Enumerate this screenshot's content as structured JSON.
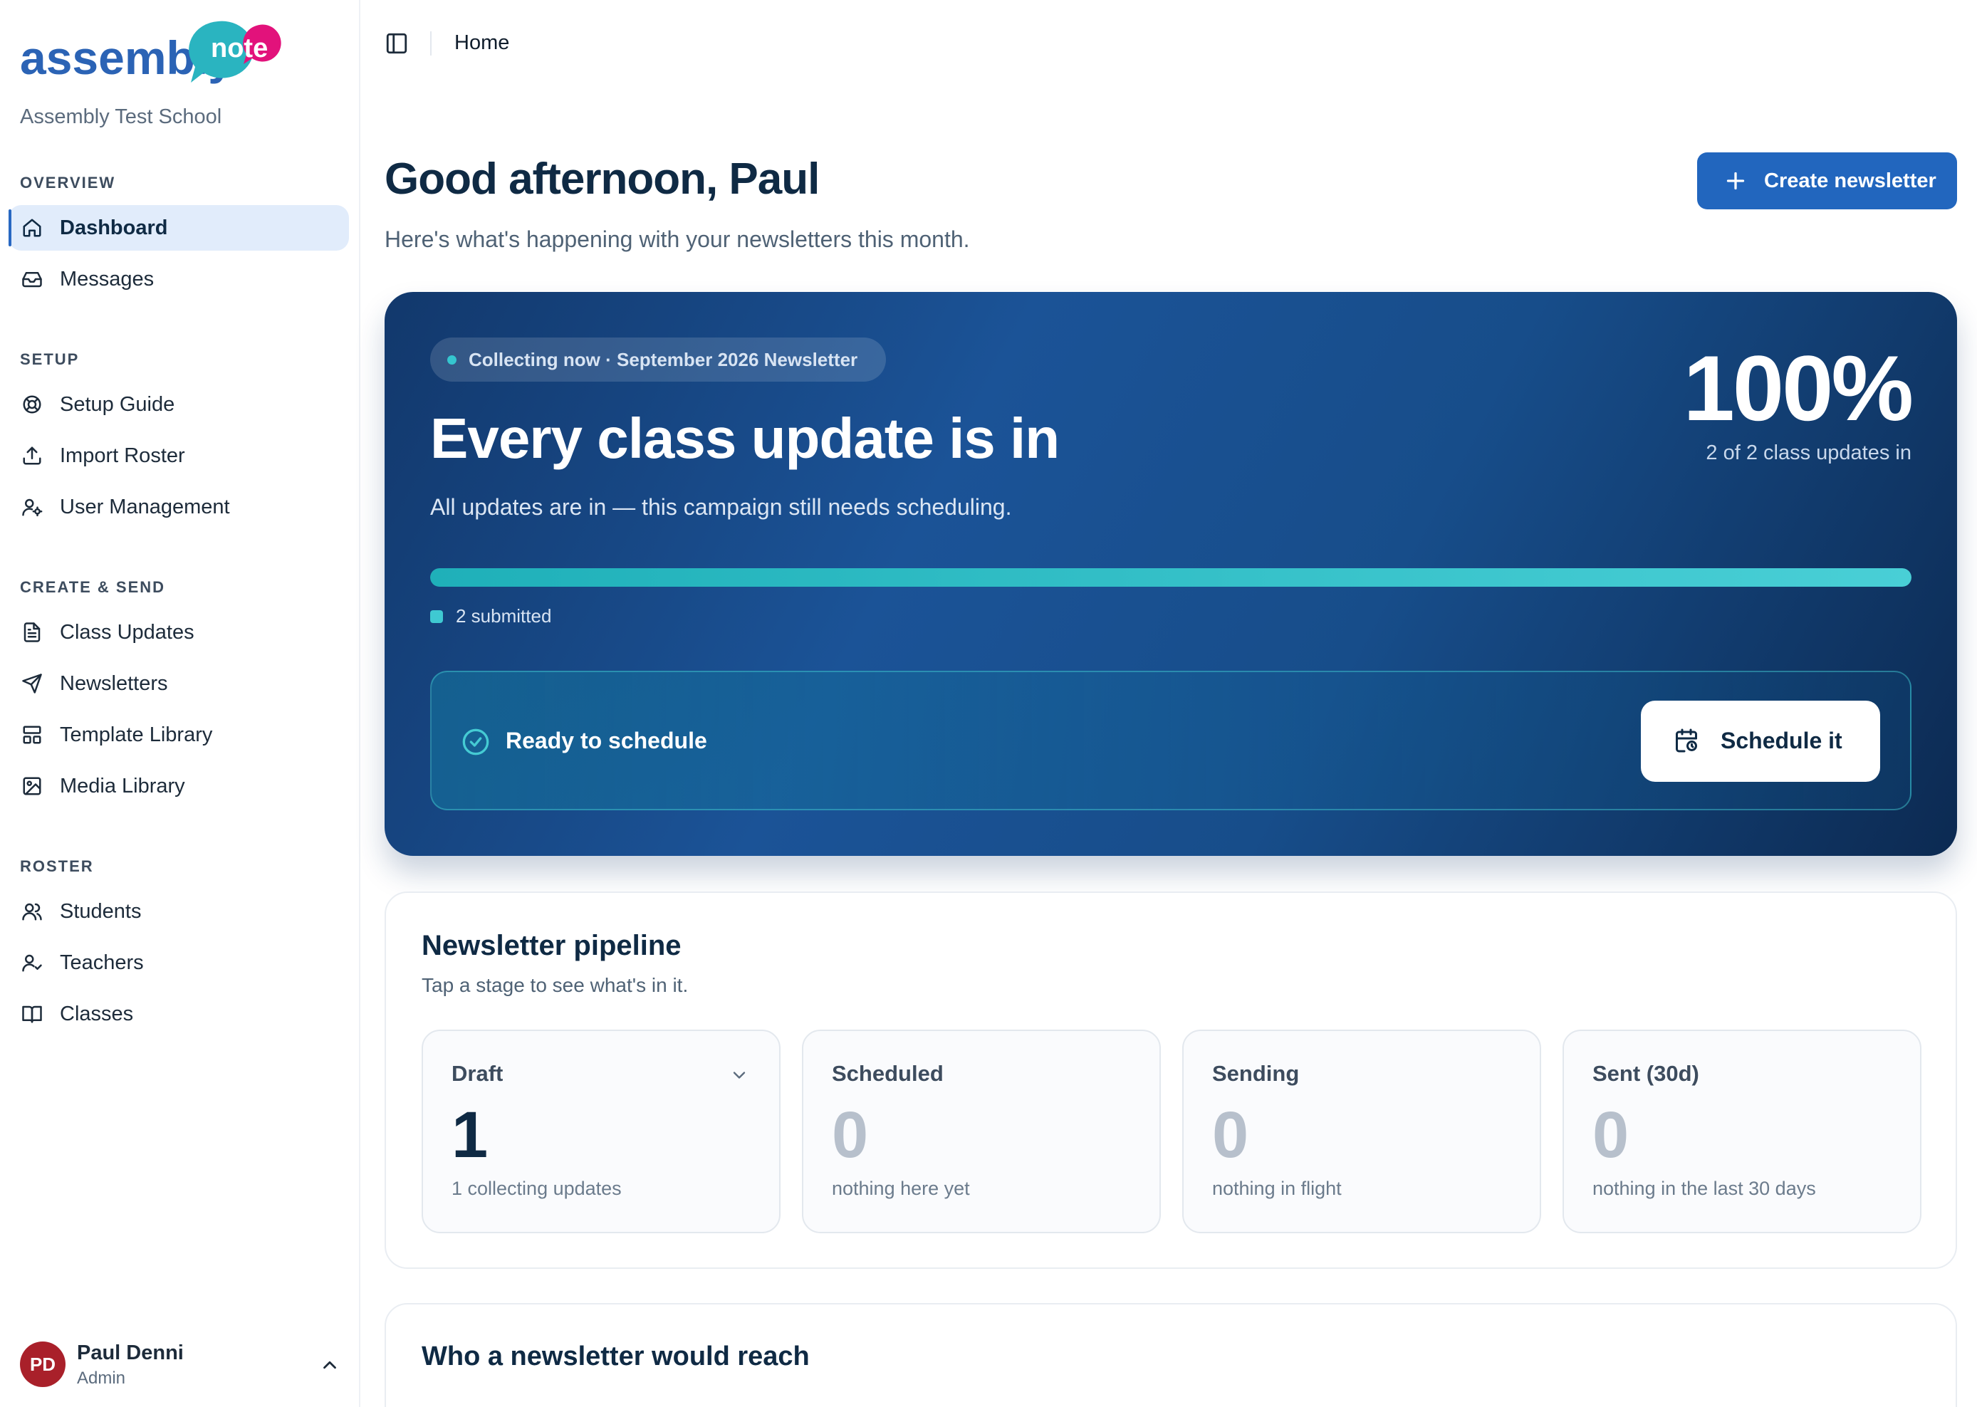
{
  "app": {
    "logo_text": "assembly",
    "logo_badge": "note",
    "school_name": "Assembly Test School"
  },
  "sidebar": {
    "sections": [
      {
        "label": "OVERVIEW",
        "items": [
          {
            "label": "Dashboard",
            "icon": "home-icon",
            "active": true
          },
          {
            "label": "Messages",
            "icon": "inbox-icon"
          }
        ]
      },
      {
        "label": "SETUP",
        "items": [
          {
            "label": "Setup Guide",
            "icon": "lifebuoy-icon"
          },
          {
            "label": "Import Roster",
            "icon": "upload-icon"
          },
          {
            "label": "User Management",
            "icon": "user-cog-icon"
          }
        ]
      },
      {
        "label": "CREATE & SEND",
        "items": [
          {
            "label": "Class Updates",
            "icon": "document-icon"
          },
          {
            "label": "Newsletters",
            "icon": "send-icon"
          },
          {
            "label": "Template Library",
            "icon": "layout-icon"
          },
          {
            "label": "Media Library",
            "icon": "image-icon"
          }
        ]
      },
      {
        "label": "ROSTER",
        "items": [
          {
            "label": "Students",
            "icon": "users-icon"
          },
          {
            "label": "Teachers",
            "icon": "user-check-icon"
          },
          {
            "label": "Classes",
            "icon": "book-icon"
          }
        ]
      }
    ],
    "user": {
      "initials": "PD",
      "name": "Paul Denni",
      "role": "Admin"
    }
  },
  "topbar": {
    "breadcrumb": "Home"
  },
  "header": {
    "greeting": "Good afternoon, Paul",
    "subtitle": "Here's what's happening with your newsletters this month.",
    "create_button": "Create newsletter"
  },
  "hero": {
    "pill": "Collecting now · September 2026 Newsletter",
    "title": "Every class update is in",
    "description": "All updates are in — this campaign still needs scheduling.",
    "percent": "100%",
    "percent_sub": "2 of 2 class updates in",
    "progress_fraction": 1.0,
    "legend": "2 submitted",
    "ready_text": "Ready to schedule",
    "schedule_button": "Schedule it"
  },
  "pipeline": {
    "title": "Newsletter pipeline",
    "subtitle": "Tap a stage to see what's in it.",
    "stages": [
      {
        "name": "Draft",
        "count": "1",
        "note": "1 collecting updates"
      },
      {
        "name": "Scheduled",
        "count": "0",
        "note": "nothing here yet"
      },
      {
        "name": "Sending",
        "count": "0",
        "note": "nothing in flight"
      },
      {
        "name": "Sent (30d)",
        "count": "0",
        "note": "nothing in the last 30 days"
      }
    ]
  },
  "reach": {
    "title": "Who a newsletter would reach"
  },
  "colors": {
    "primary": "#2266be",
    "accent_teal": "#35c6cf",
    "logo_pink": "#e2127b",
    "avatar": "#a9202a"
  }
}
